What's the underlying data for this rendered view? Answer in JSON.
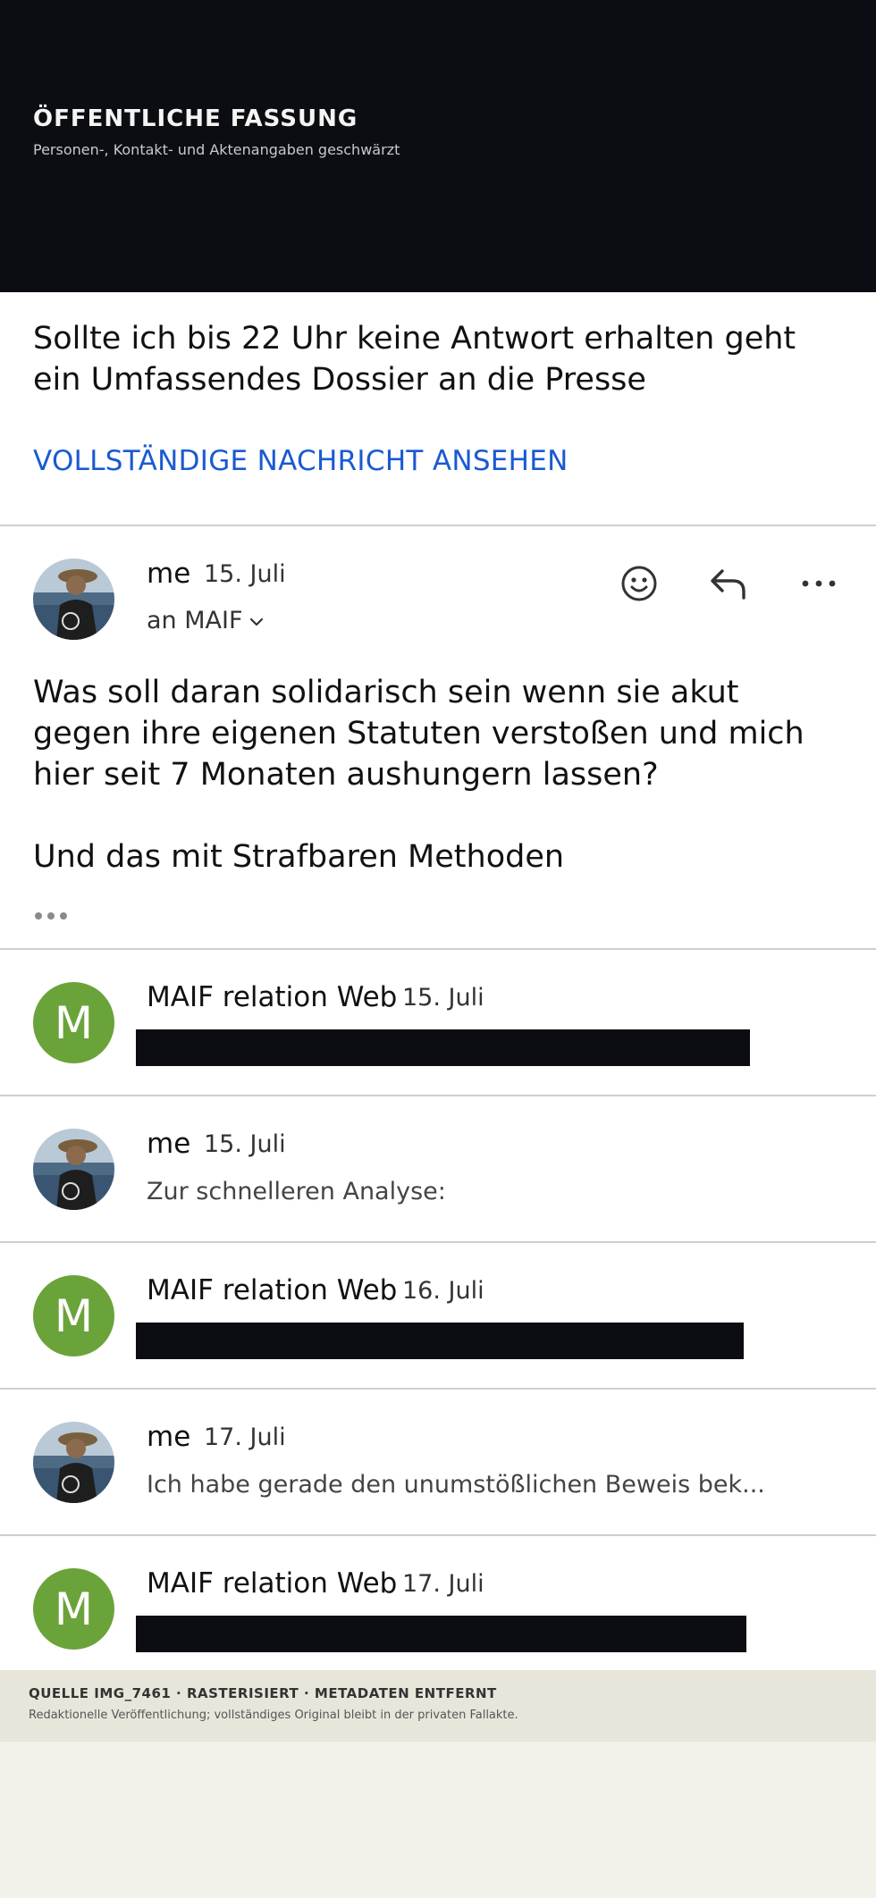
{
  "banner": {
    "title": "ÖFFENTLICHE FASSUNG",
    "subtitle": "Personen-, Kontakt- und Aktenangaben geschwärzt"
  },
  "preview": {
    "text": "Sollte ich bis 22 Uhr keine Antwort erhalten geht ein Umfassendes Dossier an die Presse",
    "view_full_label": "VOLLSTÄNDIGE NACHRICHT ANSEHEN"
  },
  "expanded": {
    "sender": "me",
    "date": "15. Juli",
    "to": "an MAIF",
    "icons": {
      "emoji": "smiley-icon",
      "reply": "reply-icon",
      "more": "more-icon"
    },
    "body_p1": "Was soll daran solidarisch sein wenn sie akut gegen ihre eigenen Statuten verstoßen und mich hier seit 7 Monaten aushungern lassen?",
    "body_p2": "Und das mit Strafbaren Methoden"
  },
  "thread": [
    {
      "sender": "MAIF relation Web",
      "date": "15. Juli",
      "avatar": "M",
      "snippet": ""
    },
    {
      "sender": "me",
      "date": "15. Juli",
      "avatar": "photo",
      "snippet": "Zur schnelleren Analyse:"
    },
    {
      "sender": "MAIF relation Web",
      "date": "16. Juli",
      "avatar": "M",
      "snippet": ""
    },
    {
      "sender": "me",
      "date": "17. Juli",
      "avatar": "photo",
      "snippet": "Ich habe gerade den unumstößlichen Beweis bek..."
    },
    {
      "sender": "MAIF relation Web",
      "date": "17. Juli",
      "avatar": "M",
      "snippet": ""
    }
  ],
  "footer": {
    "title": "QUELLE IMG_7461 · RASTERISIERT · METADATEN ENTFERNT",
    "subtitle": "Redaktionelle Veröffentlichung; vollständiges Original bleibt in der privaten Fallakte."
  },
  "colors": {
    "accent": "#1a5ad1",
    "avatar_m": "#6aa33a",
    "redaction": "#0b0d12"
  }
}
